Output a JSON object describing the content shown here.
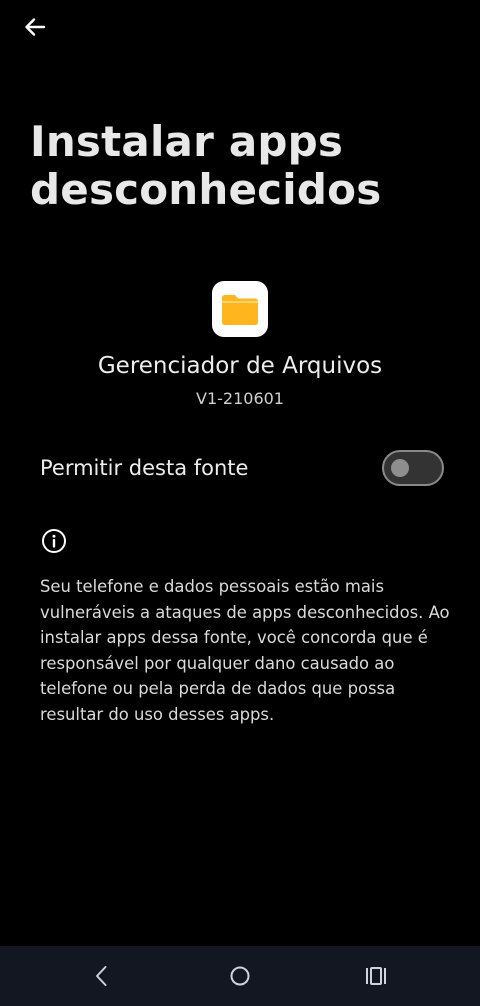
{
  "header": {
    "back_icon": "arrow-left-icon",
    "title": "Instalar apps desconhecidos"
  },
  "app": {
    "icon": "folder-icon",
    "icon_color": "#FFB51E",
    "name": "Gerenciador de Arquivos",
    "version": "V1-210601"
  },
  "setting": {
    "label": "Permitir desta fonte",
    "enabled": false
  },
  "info": {
    "icon": "info-icon",
    "text": "Seu telefone e dados pessoais estão mais vulneráveis a ataques de apps desconhecidos. Ao instalar apps dessa fonte, você concorda que é responsável por qualquer dano causado ao telefone ou pela perda de dados que possa resultar do uso desses apps."
  },
  "navbar": {
    "buttons": [
      "back-icon",
      "home-icon",
      "recents-icon"
    ]
  },
  "colors": {
    "background": "#000000",
    "navbar": "#121722",
    "folder": "#FFB51E"
  }
}
